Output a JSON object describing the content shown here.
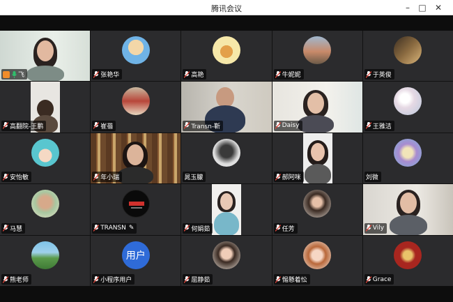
{
  "window": {
    "title": "腾讯会议"
  },
  "accent_color": "#2fbf6c",
  "participants": [
    {
      "name": "飞"
    },
    {
      "name": "张艳华"
    },
    {
      "name": "高艳"
    },
    {
      "name": "牛妮妮"
    },
    {
      "name": "于英俊"
    },
    {
      "name": "高翻院-王鹏"
    },
    {
      "name": "崔蓓"
    },
    {
      "name": "Transn-靳"
    },
    {
      "name": "Daisy"
    },
    {
      "name": "王雅洁"
    },
    {
      "name": "安怡敏"
    },
    {
      "name": "年小瑞"
    },
    {
      "name": "晁玉朦"
    },
    {
      "name": "郝阿咪"
    },
    {
      "name": "刘微"
    },
    {
      "name": "马慧"
    },
    {
      "name": "TRANSN"
    },
    {
      "name": "何娟茹"
    },
    {
      "name": "任芳"
    },
    {
      "name": "Vily"
    },
    {
      "name": "熊老师"
    },
    {
      "name": "小程序用户",
      "avatar_text": "用户"
    },
    {
      "name": "屈静茹"
    },
    {
      "name": "惕懸着忪"
    },
    {
      "name": "Grace"
    }
  ],
  "icons": {
    "mic": "mic-muted-icon",
    "person": "person-icon",
    "edit": "pencil-icon"
  }
}
